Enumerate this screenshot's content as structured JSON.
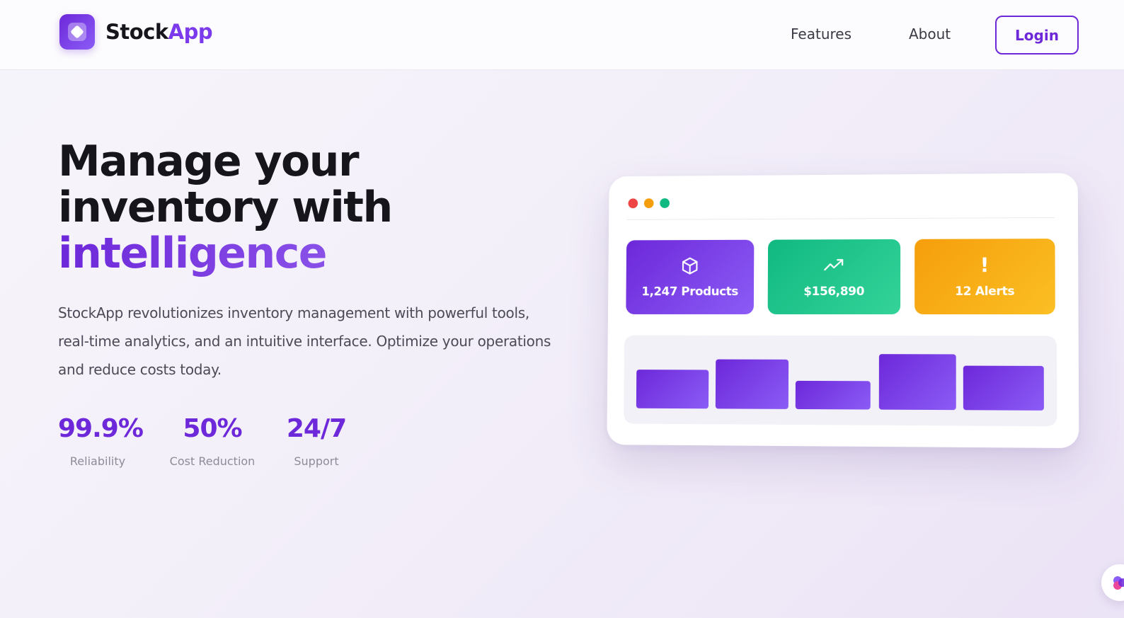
{
  "brand": {
    "name_part1": "Stock",
    "name_part2": "App",
    "logo_icon": "diamond-logo-icon",
    "colors": {
      "primary": "#6d28d9",
      "accent": "#8b5cf6",
      "success": "#10b981",
      "warning": "#f59e0b",
      "danger": "#ef4444"
    }
  },
  "nav": {
    "items": [
      {
        "label": "Features"
      },
      {
        "label": "About"
      }
    ],
    "login_label": "Login"
  },
  "hero": {
    "title_line1": "Manage your",
    "title_line2": "inventory with",
    "title_accent": "intelligence",
    "description": "StockApp revolutionizes inventory management with powerful tools, real-time analytics, and an intuitive interface. Optimize your operations and reduce costs today.",
    "stats": [
      {
        "value": "99.9%",
        "label": "Reliability"
      },
      {
        "value": "50%",
        "label": "Cost Reduction"
      },
      {
        "value": "24/7",
        "label": "Support"
      }
    ]
  },
  "dashboard_preview": {
    "cards": [
      {
        "label": "1,247 Products",
        "icon": "box-icon",
        "color": "#6d28d9"
      },
      {
        "label": "$156,890",
        "icon": "trending-up-icon",
        "color": "#10b981"
      },
      {
        "label": "12 Alerts",
        "icon": "alert-icon",
        "icon_glyph": "!",
        "color": "#f59e0b"
      }
    ],
    "chart_bars": [
      0.55,
      0.7,
      0.4,
      0.78,
      0.62
    ]
  },
  "floating_badge": {
    "icon": "brain-icon"
  }
}
